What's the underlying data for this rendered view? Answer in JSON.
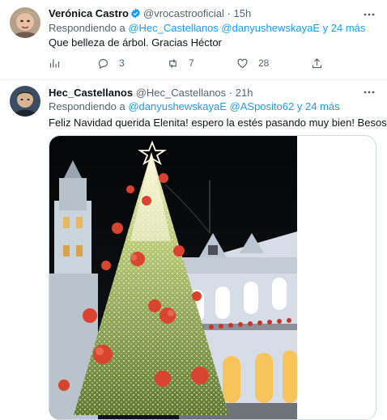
{
  "tweets": [
    {
      "display_name": "Verónica Castro",
      "handle": "@vrocastrooficial",
      "separator": "·",
      "time": "15h",
      "reply_prefix": "Respondiendo a",
      "reply_mentions": "@Hec_Castellanos @danyushewskayaE",
      "reply_suffix": "y 24 más",
      "text": "Que belleza de árbol. Gracias Héctor",
      "replies": "3",
      "retweets": "7",
      "likes": "28"
    },
    {
      "display_name": "Hec_Castellanos",
      "handle": "@Hec_Castellanos",
      "separator": "·",
      "time": "21h",
      "reply_prefix": "Respondiendo a",
      "reply_mentions": "@danyushewskayaE @ASposito62",
      "reply_suffix": "y 24 más",
      "text": "Feliz Navidad querida Elenita! espero la estés pasando muy bien! Besos!"
    }
  ],
  "icons": {
    "analytics": "bar-chart-icon",
    "reply": "speech-bubble-icon",
    "retweet": "retweet-arrows-icon",
    "like": "heart-icon",
    "share": "share-upload-icon",
    "verified": "verified-badge-icon",
    "more": "more-dots-icon"
  },
  "colors": {
    "link": "#1d9bf0",
    "secondary_text": "#536471",
    "primary_text": "#0f1419",
    "verified": "#1d9bf0"
  }
}
